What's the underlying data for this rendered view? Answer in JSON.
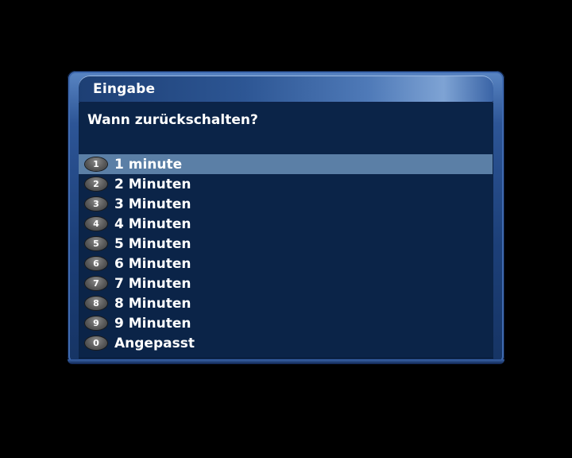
{
  "dialog": {
    "title": "Eingabe",
    "question": "Wann zurückschalten?",
    "selected_index": 0,
    "options": [
      {
        "key": "1",
        "label": "1 minute"
      },
      {
        "key": "2",
        "label": "2 Minuten"
      },
      {
        "key": "3",
        "label": "3 Minuten"
      },
      {
        "key": "4",
        "label": "4 Minuten"
      },
      {
        "key": "5",
        "label": "5 Minuten"
      },
      {
        "key": "6",
        "label": "6 Minuten"
      },
      {
        "key": "7",
        "label": "7 Minuten"
      },
      {
        "key": "8",
        "label": "8 Minuten"
      },
      {
        "key": "9",
        "label": "9 Minuten"
      },
      {
        "key": "0",
        "label": "Angepasst"
      }
    ]
  },
  "colors": {
    "background": "#000000",
    "content_bg": "#0b2448",
    "selection": "#5b7fa6",
    "text": "#ffffff"
  }
}
